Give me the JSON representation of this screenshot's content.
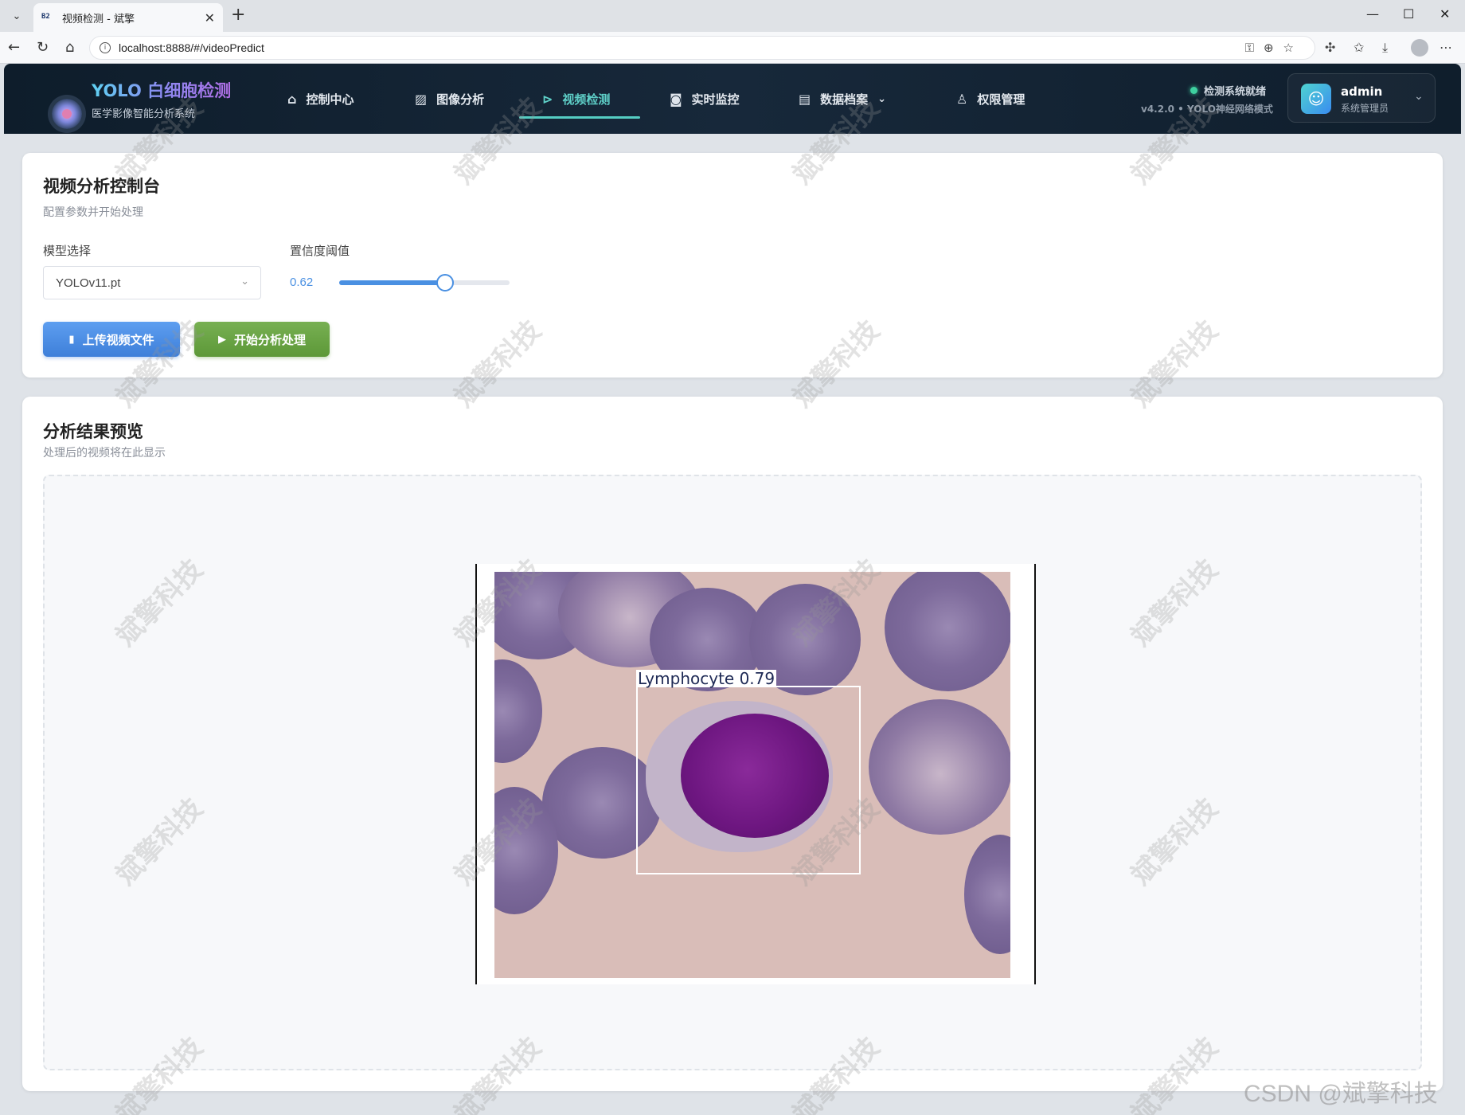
{
  "browser": {
    "tab_title": "视频检测 - 斌擎",
    "favicon_text": "B2",
    "url": "localhost:8888/#/videoPredict"
  },
  "app": {
    "brand_title": "YOLO 白细胞检测",
    "brand_subtitle": "医学影像智能分析系统",
    "nav": [
      {
        "label": "控制中心",
        "icon": "home-icon"
      },
      {
        "label": "图像分析",
        "icon": "image-icon"
      },
      {
        "label": "视频检测",
        "icon": "play-circle-icon",
        "active": true
      },
      {
        "label": "实时监控",
        "icon": "camera-icon"
      },
      {
        "label": "数据档案",
        "icon": "document-icon",
        "has_dropdown": true
      },
      {
        "label": "权限管理",
        "icon": "user-icon"
      }
    ],
    "status_text": "检测系统就绪",
    "version_text": "v4.2.0 • YOLO神经网络模式",
    "user": {
      "name": "admin",
      "role": "系统管理员"
    },
    "colors": {
      "accent": "#55cdc3",
      "status_ok": "#3ed0a0",
      "primary": "#4a90e2",
      "success": "#6aa545"
    }
  },
  "control_panel": {
    "title": "视频分析控制台",
    "subtitle": "配置参数并开始处理",
    "model_label": "模型选择",
    "model_value": "YOLOv11.pt",
    "confidence_label": "置信度阈值",
    "confidence_value": "0.62",
    "confidence_fraction": 0.62,
    "upload_button": "上传视频文件",
    "start_button": "开始分析处理"
  },
  "result_panel": {
    "title": "分析结果预览",
    "subtitle": "处理后的视频将在此显示",
    "detection_label": "Lymphocyte  0.79"
  },
  "watermark_text": "斌擎科技",
  "csdn_watermark": "CSDN @斌擎科技"
}
